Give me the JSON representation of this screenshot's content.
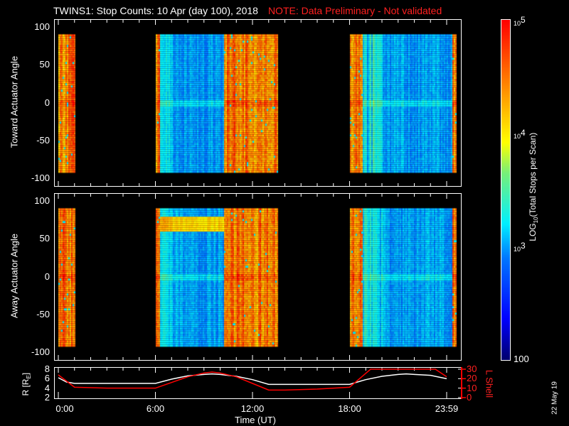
{
  "title": "TWINS1: Stop Counts: 10 Apr (day 100), 2018",
  "note": "NOTE: Data Preliminary - Not validated",
  "date_stamp": "22 May 19",
  "chart_data": [
    {
      "type": "heatmap",
      "name": "toward",
      "ylabel": "Toward Actuator Angle",
      "yticks": [
        "100",
        "50",
        "0",
        "-50",
        "-100"
      ],
      "ylim": [
        -110,
        110
      ],
      "angle_range": [
        -90,
        90
      ],
      "time_coverage_hours": [
        [
          0,
          1.0
        ],
        [
          6.0,
          13.5
        ],
        [
          18.0,
          24.6
        ]
      ],
      "quiet_intervals_hours": [
        [
          6.2,
          10.2
        ],
        [
          18.8,
          24.3
        ]
      ]
    },
    {
      "type": "heatmap",
      "name": "away",
      "ylabel": "Away Actuator Angle",
      "yticks": [
        "100",
        "50",
        "0",
        "-50",
        "-100"
      ],
      "ylim": [
        -110,
        110
      ],
      "angle_range": [
        -90,
        90
      ],
      "time_coverage_hours": [
        [
          0,
          1.0
        ],
        [
          6.0,
          13.5
        ],
        [
          18.0,
          24.6
        ]
      ],
      "quiet_intervals_hours": [
        [
          6.2,
          10.2
        ],
        [
          18.8,
          24.3
        ]
      ]
    },
    {
      "type": "line",
      "name": "orbit",
      "xlabel": "Time (UT)",
      "xticks": [
        "0:00",
        "6:00",
        "12:00",
        "18:00",
        "23:59"
      ],
      "xtick_hours": [
        0,
        6,
        12,
        18,
        24
      ],
      "ylabel_left": "R [RE]",
      "ylabel_left_main": "R [R",
      "ylabel_left_sub": "E",
      "ylabel_left_end": "]",
      "yticks_left": [
        "8",
        "6",
        "4",
        "2"
      ],
      "ylim_left": [
        2,
        8
      ],
      "ylabel_right": "L Shell",
      "yticks_right": [
        "30",
        "20",
        "10",
        "0"
      ],
      "ylim_right": [
        0,
        30
      ],
      "series": [
        {
          "name": "R",
          "color": "#ffffff",
          "x": [
            0,
            0.5,
            1,
            6,
            7,
            8,
            9,
            9.5,
            10,
            11,
            12,
            13,
            14,
            16,
            18,
            19,
            20,
            21,
            21.5,
            22,
            23,
            24
          ],
          "y": [
            6.2,
            5.3,
            5.0,
            5.0,
            5.9,
            6.6,
            6.9,
            7.0,
            6.9,
            6.5,
            5.8,
            4.8,
            4.8,
            4.8,
            4.8,
            5.8,
            6.5,
            6.9,
            7.0,
            6.9,
            6.7,
            6.0
          ]
        },
        {
          "name": "L Shell",
          "color": "#ff0000",
          "x": [
            0,
            1,
            3,
            6,
            7,
            8,
            9,
            9.5,
            10,
            11,
            12,
            13,
            14,
            16,
            18,
            19.3,
            23.3,
            24
          ],
          "y": [
            24,
            11,
            10,
            10,
            16,
            22,
            26,
            27,
            26,
            22,
            15,
            8,
            8,
            9,
            11,
            30,
            30,
            22
          ]
        }
      ]
    }
  ],
  "colorbar": {
    "label_main": "LOG",
    "label_sub": "10",
    "label_rest": "(Total Stops per Scan)",
    "ticks": [
      {
        "base": "10",
        "exp": "5"
      },
      {
        "base": "10",
        "exp": "4"
      },
      {
        "base": "10",
        "exp": "3"
      },
      {
        "base": "100",
        "exp": ""
      }
    ],
    "range": [
      100,
      100000
    ]
  }
}
